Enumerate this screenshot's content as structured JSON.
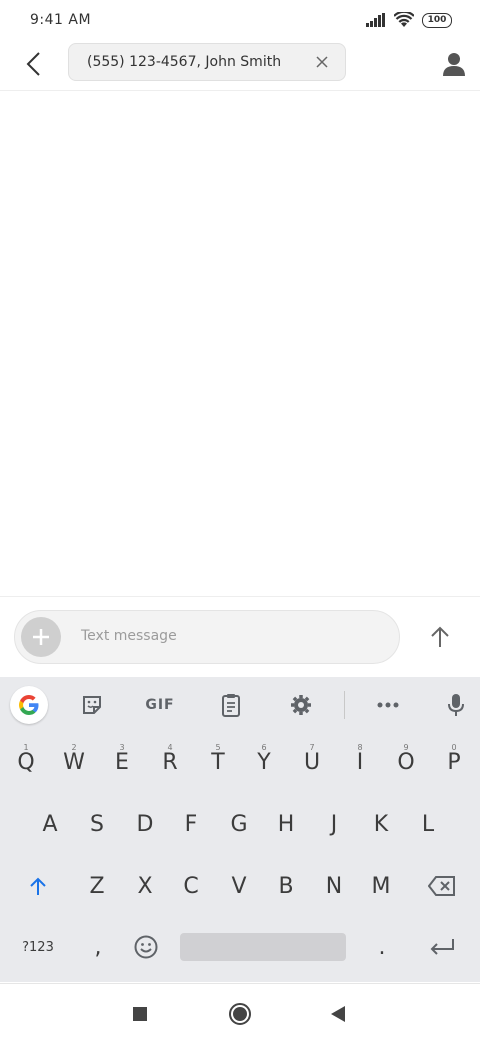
{
  "status_bar": {
    "time": "9:41 AM",
    "battery": "100"
  },
  "top_bar": {
    "recipient_text": "(555) 123-4567, John Smith"
  },
  "compose": {
    "placeholder": "Text message"
  },
  "keyboard": {
    "toolbar": {
      "gif_label": "GIF"
    },
    "rows": [
      [
        {
          "key": "Q",
          "hint": "1"
        },
        {
          "key": "W",
          "hint": "2"
        },
        {
          "key": "E",
          "hint": "3"
        },
        {
          "key": "R",
          "hint": "4"
        },
        {
          "key": "T",
          "hint": "5"
        },
        {
          "key": "Y",
          "hint": "6"
        },
        {
          "key": "U",
          "hint": "7"
        },
        {
          "key": "I",
          "hint": "8"
        },
        {
          "key": "O",
          "hint": "9"
        },
        {
          "key": "P",
          "hint": "0"
        }
      ],
      [
        {
          "key": "A"
        },
        {
          "key": "S"
        },
        {
          "key": "D"
        },
        {
          "key": "F"
        },
        {
          "key": "G"
        },
        {
          "key": "H"
        },
        {
          "key": "J"
        },
        {
          "key": "K"
        },
        {
          "key": "L"
        }
      ],
      [
        {
          "key": "Z"
        },
        {
          "key": "X"
        },
        {
          "key": "C"
        },
        {
          "key": "V"
        },
        {
          "key": "B"
        },
        {
          "key": "N"
        },
        {
          "key": "M"
        }
      ]
    ],
    "symbols_key": "?123",
    "comma_key": ",",
    "period_key": "."
  },
  "colors": {
    "accent_shift": "#1a73e8",
    "keyboard_bg": "#e9eaed",
    "compose_bg": "#f3f3f3"
  }
}
